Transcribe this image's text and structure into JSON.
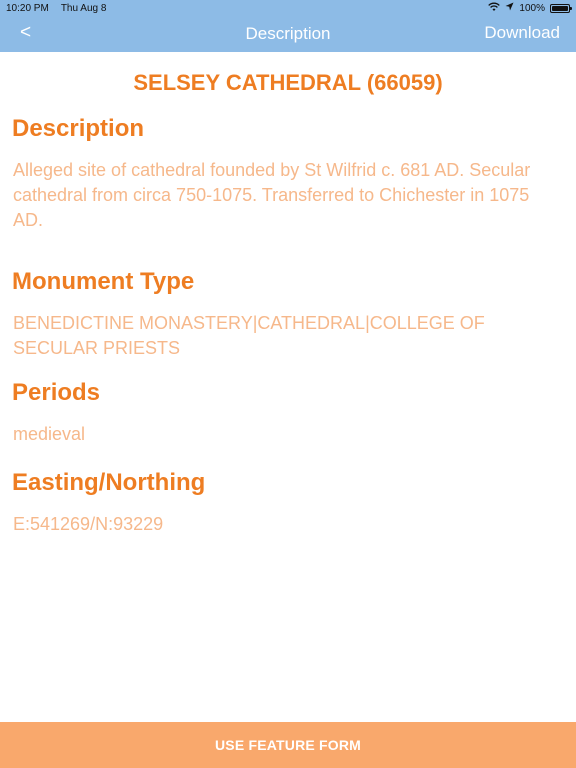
{
  "status_bar": {
    "time": "10:20 PM",
    "date": "Thu Aug 8",
    "battery": "100%"
  },
  "nav": {
    "back_label": "<",
    "title": "Description",
    "action_label": "Download"
  },
  "feature": {
    "title": "SELSEY CATHEDRAL (66059)"
  },
  "sections": {
    "description": {
      "heading": "Description",
      "body": "Alleged site of cathedral founded by St Wilfrid c. 681 AD. Secular cathedral from circa 750-1075. Transferred to Chichester in 1075 AD."
    },
    "monument_type": {
      "heading": "Monument Type",
      "body": "BENEDICTINE MONASTERY|CATHEDRAL|COLLEGE OF SECULAR PRIESTS"
    },
    "periods": {
      "heading": "Periods",
      "body": "medieval"
    },
    "easting_northing": {
      "heading": "Easting/Northing",
      "body": "E:541269/N:93229"
    }
  },
  "bottom_button": {
    "label": "USE FEATURE FORM"
  },
  "colors": {
    "nav_background": "#8dbbe6",
    "heading": "#ee7d22",
    "body_text": "#f6b88b",
    "button_background": "#f9a86c"
  }
}
